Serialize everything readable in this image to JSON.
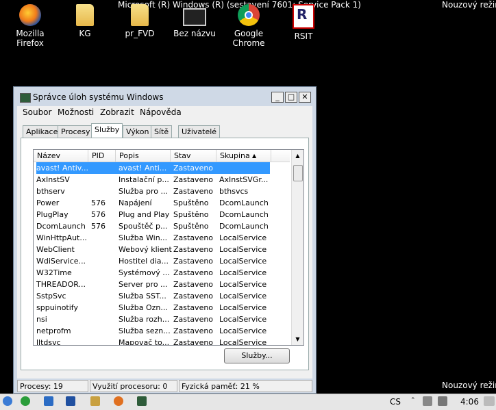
{
  "desktop": {
    "top_title": "Microsoft (R) Windows (R) (sestavení 7601: Service Pack 1)",
    "top_right": "Nouzový režim",
    "bottom_right": "Nouzový režim",
    "icons": [
      {
        "label": "Mozilla Firefox",
        "icon": "firefox-icon"
      },
      {
        "label": "KG",
        "icon": "folder-icon"
      },
      {
        "label": "pr_FVD",
        "icon": "folder-icon"
      },
      {
        "label": "Bez názvu",
        "icon": "monitor-icon"
      },
      {
        "label": "Google Chrome",
        "icon": "chrome-icon"
      },
      {
        "label": "RSIT",
        "icon": "rsit-icon"
      }
    ]
  },
  "window": {
    "title": "Správce úloh systému Windows",
    "menu": [
      "Soubor",
      "Možnosti",
      "Zobrazit",
      "Nápověda"
    ],
    "tabs": [
      "Aplikace",
      "Procesy",
      "Služby",
      "Výkon",
      "Sítě",
      "Uživatelé"
    ],
    "active_tab": "Služby",
    "columns": [
      "Název",
      "PID",
      "Popis",
      "Stav",
      "Skupina"
    ],
    "rows": [
      {
        "name": "avast! Antiv...",
        "pid": "",
        "desc": "avast! Anti...",
        "state": "Zastaveno",
        "group": ""
      },
      {
        "name": "AxInstSV",
        "pid": "",
        "desc": "Instalační p...",
        "state": "Zastaveno",
        "group": "AxInstSVGr..."
      },
      {
        "name": "bthserv",
        "pid": "",
        "desc": "Služba pro ...",
        "state": "Zastaveno",
        "group": "bthsvcs"
      },
      {
        "name": "Power",
        "pid": "576",
        "desc": "Napájení",
        "state": "Spuštěno",
        "group": "DcomLaunch"
      },
      {
        "name": "PlugPlay",
        "pid": "576",
        "desc": "Plug and Play",
        "state": "Spuštěno",
        "group": "DcomLaunch"
      },
      {
        "name": "DcomLaunch",
        "pid": "576",
        "desc": "Spouštěč p...",
        "state": "Spuštěno",
        "group": "DcomLaunch"
      },
      {
        "name": "WinHttpAut...",
        "pid": "",
        "desc": "Služba Win...",
        "state": "Zastaveno",
        "group": "LocalService"
      },
      {
        "name": "WebClient",
        "pid": "",
        "desc": "Webový klient",
        "state": "Zastaveno",
        "group": "LocalService"
      },
      {
        "name": "WdiService...",
        "pid": "",
        "desc": "Hostitel dia...",
        "state": "Zastaveno",
        "group": "LocalService"
      },
      {
        "name": "W32Time",
        "pid": "",
        "desc": "Systémový ...",
        "state": "Zastaveno",
        "group": "LocalService"
      },
      {
        "name": "THREADOR...",
        "pid": "",
        "desc": "Server pro ...",
        "state": "Zastaveno",
        "group": "LocalService"
      },
      {
        "name": "SstpSvc",
        "pid": "",
        "desc": "Služba SST...",
        "state": "Zastaveno",
        "group": "LocalService"
      },
      {
        "name": "sppuinotify",
        "pid": "",
        "desc": "Služba Ozn...",
        "state": "Zastaveno",
        "group": "LocalService"
      },
      {
        "name": "nsi",
        "pid": "",
        "desc": "Služba rozh...",
        "state": "Zastaveno",
        "group": "LocalService"
      },
      {
        "name": "netprofm",
        "pid": "",
        "desc": "Služba sezn...",
        "state": "Zastaveno",
        "group": "LocalService"
      },
      {
        "name": "lltdsvc",
        "pid": "",
        "desc": "Mapovač to...",
        "state": "Zastaveno",
        "group": "LocalService"
      }
    ],
    "services_button": "Služby...",
    "status": {
      "processes": "Procesy: 19",
      "cpu": "Využití procesoru: 0 %",
      "memory": "Fyzická paměť: 21 %"
    }
  },
  "taskbar": {
    "language": "CS",
    "time": "4:06",
    "colors": {
      "selection": "#3399ff",
      "desktop": "#000000"
    }
  }
}
